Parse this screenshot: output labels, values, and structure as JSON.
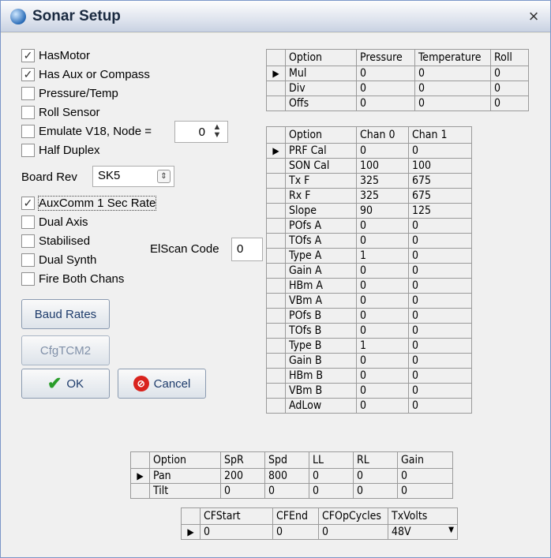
{
  "window": {
    "title": "Sonar Setup",
    "close_label": "×"
  },
  "checkboxes_top": [
    {
      "label": "HasMotor",
      "checked": true
    },
    {
      "label": "Has Aux or Compass",
      "checked": true
    },
    {
      "label": "Pressure/Temp",
      "checked": false
    },
    {
      "label": "Roll Sensor",
      "checked": false
    },
    {
      "label": "Emulate V18, Node =",
      "checked": false
    },
    {
      "label": "Half Duplex",
      "checked": false
    }
  ],
  "node_spin": {
    "value": "0"
  },
  "board_rev": {
    "label": "Board Rev",
    "value": "SK5"
  },
  "checkboxes_bottom": [
    {
      "label": "AuxComm 1 Sec Rate",
      "checked": true
    },
    {
      "label": "Dual Axis",
      "checked": false
    },
    {
      "label": "Stabilised",
      "checked": false
    },
    {
      "label": "Dual Synth",
      "checked": false
    },
    {
      "label": "Fire Both Chans",
      "checked": false
    }
  ],
  "elscan": {
    "label": "ElScan Code",
    "value": "0"
  },
  "buttons": {
    "baud_rates": "Baud Rates",
    "cfgtcm2": "CfgTCM2",
    "ok": "OK",
    "cancel": "Cancel"
  },
  "check_mark": "✓",
  "row_indicator": "▶",
  "sensor_table": {
    "headers": [
      "Option",
      "Pressure",
      "Temperature",
      "Roll"
    ],
    "rows": [
      [
        "Mul",
        "0",
        "0",
        "0"
      ],
      [
        "Div",
        "0",
        "0",
        "0"
      ],
      [
        "Offs",
        "0",
        "0",
        "0"
      ]
    ]
  },
  "chan_table": {
    "headers": [
      "Option",
      "Chan 0",
      "Chan 1"
    ],
    "rows": [
      [
        "PRF Cal",
        "0",
        "0"
      ],
      [
        "SON Cal",
        "100",
        "100"
      ],
      [
        "Tx F",
        "325",
        "675"
      ],
      [
        "Rx F",
        "325",
        "675"
      ],
      [
        "Slope",
        "90",
        "125"
      ],
      [
        "POfs A",
        "0",
        "0"
      ],
      [
        "TOfs A",
        "0",
        "0"
      ],
      [
        "Type A",
        "1",
        "0"
      ],
      [
        "Gain A",
        "0",
        "0"
      ],
      [
        "HBm A",
        "0",
        "0"
      ],
      [
        "VBm A",
        "0",
        "0"
      ],
      [
        "POfs B",
        "0",
        "0"
      ],
      [
        "TOfs B",
        "0",
        "0"
      ],
      [
        "Type B",
        "1",
        "0"
      ],
      [
        "Gain B",
        "0",
        "0"
      ],
      [
        "HBm B",
        "0",
        "0"
      ],
      [
        "VBm B",
        "0",
        "0"
      ],
      [
        "AdLow",
        "0",
        "0"
      ]
    ]
  },
  "motor_table": {
    "headers": [
      "Option",
      "SpR",
      "Spd",
      "LL",
      "RL",
      "Gain"
    ],
    "rows": [
      [
        "Pan",
        "200",
        "800",
        "0",
        "0",
        "0"
      ],
      [
        "Tilt",
        "0",
        "0",
        "0",
        "0",
        "0"
      ]
    ]
  },
  "cf_table": {
    "headers": [
      "CFStart",
      "CFEnd",
      "CFOpCycles",
      "TxVolts"
    ],
    "rows": [
      [
        "0",
        "0",
        "0",
        "48V"
      ]
    ]
  }
}
